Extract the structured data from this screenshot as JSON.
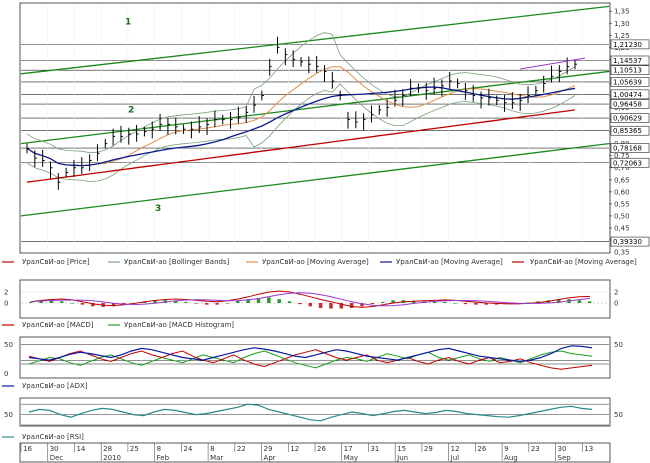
{
  "chart_data": {
    "type": "line",
    "main": {
      "ticks": [
        "1,35",
        "1,30",
        "1,25",
        "1,20",
        "1,15",
        "1,10",
        "1,05",
        "1,00",
        "0,95",
        "0,90",
        "0,85",
        "0,80",
        "0,75",
        "0,70",
        "0,65",
        "0,60",
        "0,55",
        "0,50",
        "0,45",
        "0,40",
        "0,35"
      ],
      "ylim": [
        0.35,
        1.38
      ],
      "price_labels": [
        "1,21230",
        "1,14537",
        "1,10513",
        "1,05639",
        "1,00474",
        "0,96458",
        "0,90629",
        "0,85365",
        "0,78168",
        "0,72063",
        "0,39330"
      ],
      "price_label_values": [
        1.2123,
        1.14537,
        1.10513,
        1.05639,
        1.00474,
        0.96458,
        0.90629,
        0.85365,
        0.78168,
        0.72063,
        0.3933
      ],
      "annotations": [
        "1",
        "2",
        "3"
      ],
      "close": [
        0.78,
        0.74,
        0.73,
        0.7,
        0.64,
        0.68,
        0.7,
        0.7,
        0.73,
        0.76,
        0.8,
        0.83,
        0.83,
        0.84,
        0.84,
        0.85,
        0.86,
        0.88,
        0.88,
        0.87,
        0.86,
        0.86,
        0.87,
        0.88,
        0.9,
        0.9,
        0.9,
        0.91,
        0.93,
        0.96,
        1.0,
        1.12,
        1.2,
        1.17,
        1.15,
        1.14,
        1.13,
        1.12,
        1.1,
        1.06,
        1.0,
        0.9,
        0.89,
        0.9,
        0.92,
        0.94,
        0.95,
        0.98,
        1.0,
        1.03,
        1.03,
        1.02,
        1.03,
        1.04,
        1.06,
        1.05,
        1.02,
        1.0,
        0.99,
        0.99,
        0.98,
        0.97,
        0.97,
        0.98,
        1.0,
        1.02,
        1.05,
        1.08,
        1.1,
        1.12,
        1.13
      ]
    },
    "main_legend": [
      "УралСвИ-ао [Price]",
      "УралСвИ-ао [Bollinger Bands]",
      "УралСвИ-ао [Moving Average]",
      "УралСвИ-ао [Moving Average]",
      "УралСвИ-ао [Moving Average]"
    ],
    "macd": {
      "ticks": [
        "2",
        "0"
      ],
      "legend": [
        "УралСвИ-ао [MACD]",
        "УралСвИ-ао [MACD Histogram]"
      ],
      "macd": [
        0.3,
        0.6,
        0.8,
        0.9,
        0.7,
        0.3,
        -0.2,
        -0.5,
        -0.6,
        -0.4,
        -0.1,
        0.3,
        0.6,
        0.8,
        0.9,
        0.8,
        0.6,
        0.4,
        0.3,
        0.5,
        0.9,
        1.4,
        2.0,
        2.5,
        2.7,
        2.5,
        2.0,
        1.4,
        0.8,
        0.3,
        -0.3,
        -0.8,
        -1.0,
        -0.8,
        -0.4,
        0.0,
        0.3,
        0.4,
        0.5,
        0.6,
        0.7,
        0.6,
        0.4,
        0.2,
        0.0,
        -0.1,
        -0.2,
        -0.2,
        -0.1,
        0.1,
        0.4,
        0.8,
        1.2,
        1.4,
        1.5
      ],
      "hist": [
        0.2,
        0.4,
        0.4,
        0.3,
        0.0,
        -0.3,
        -0.6,
        -0.7,
        -0.6,
        -0.3,
        0.0,
        0.3,
        0.5,
        0.5,
        0.4,
        0.2,
        -0.1,
        -0.3,
        -0.3,
        0.0,
        0.4,
        0.7,
        0.9,
        1.0,
        0.7,
        0.3,
        -0.2,
        -0.6,
        -0.9,
        -1.0,
        -1.0,
        -0.9,
        -0.6,
        -0.2,
        0.2,
        0.5,
        0.5,
        0.4,
        0.3,
        0.2,
        0.2,
        0.0,
        -0.2,
        -0.3,
        -0.3,
        -0.3,
        -0.2,
        -0.1,
        0.1,
        0.3,
        0.5,
        0.7,
        0.7,
        0.5,
        0.3
      ]
    },
    "adx": {
      "ticks": [
        "50",
        "0"
      ],
      "legend": [
        "УралСвИ-ао [ADX]"
      ],
      "adx": [
        30,
        28,
        26,
        30,
        35,
        38,
        36,
        33,
        30,
        34,
        40,
        44,
        42,
        38,
        34,
        30,
        28,
        26,
        30,
        34,
        38,
        42,
        45,
        43,
        40,
        36,
        32,
        30,
        34,
        38,
        42,
        40,
        36,
        32,
        30,
        28,
        26,
        30,
        34,
        38,
        42,
        44,
        40,
        36,
        32,
        30,
        28,
        26,
        24,
        26,
        30,
        36,
        44,
        48,
        47,
        45
      ],
      "plus_di": [
        20,
        25,
        30,
        28,
        22,
        18,
        24,
        30,
        34,
        28,
        22,
        18,
        24,
        30,
        26,
        22,
        28,
        34,
        30,
        26,
        22,
        30,
        36,
        40,
        34,
        28,
        22,
        18,
        14,
        20,
        26,
        30,
        28,
        24,
        30,
        36,
        32,
        28,
        34,
        38,
        30,
        26,
        30,
        34,
        28,
        24,
        30,
        26,
        22,
        28,
        34,
        38,
        40,
        36,
        34,
        32
      ],
      "minus_di": [
        32,
        28,
        24,
        30,
        36,
        40,
        34,
        28,
        24,
        30,
        36,
        40,
        34,
        30,
        36,
        40,
        32,
        26,
        22,
        28,
        34,
        26,
        20,
        16,
        22,
        28,
        34,
        38,
        42,
        36,
        30,
        26,
        30,
        34,
        26,
        22,
        26,
        30,
        24,
        20,
        26,
        30,
        24,
        20,
        26,
        30,
        22,
        24,
        28,
        22,
        18,
        14,
        12,
        14,
        16,
        18
      ]
    },
    "rsi": {
      "ticks": [
        "50"
      ],
      "legend": [
        "УралСвИ-ао [RSI]"
      ],
      "rsi": [
        55,
        60,
        58,
        50,
        45,
        52,
        58,
        62,
        60,
        55,
        50,
        48,
        55,
        60,
        58,
        54,
        50,
        52,
        56,
        60,
        64,
        70,
        68,
        60,
        55,
        50,
        45,
        40,
        38,
        45,
        50,
        55,
        52,
        48,
        52,
        56,
        58,
        55,
        52,
        54,
        58,
        56,
        52,
        50,
        48,
        46,
        45,
        48,
        52,
        56,
        60,
        64,
        66,
        62,
        60
      ]
    },
    "x_labels": [
      "16",
      "30",
      "14",
      "28",
      "25",
      "8",
      "24",
      "8",
      "22",
      "29",
      "12",
      "26",
      "17",
      "31",
      "15",
      "29",
      "12",
      "26",
      "9",
      "23",
      "30",
      "13"
    ],
    "month_labels": [
      "Dec",
      "2010",
      "Feb",
      "Mar",
      "Apr",
      "May",
      "Jun",
      "Jul",
      "Aug",
      "Sep"
    ]
  }
}
